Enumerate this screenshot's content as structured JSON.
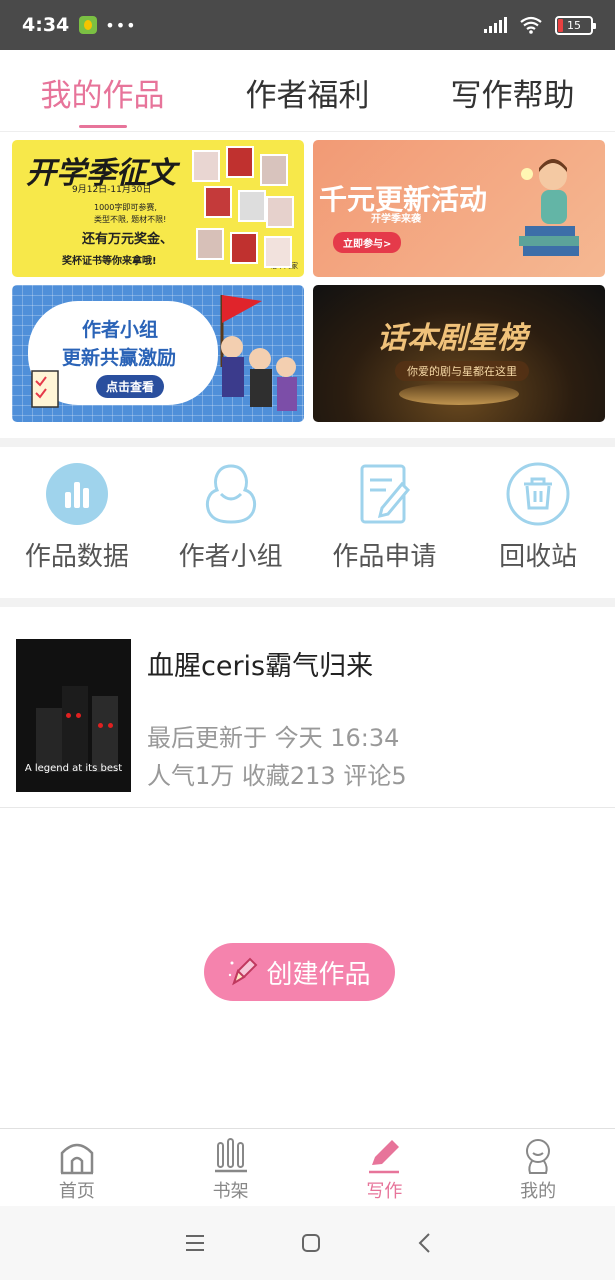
{
  "status_bar": {
    "time": "4:34",
    "dots": "•••",
    "battery": "15"
  },
  "tabs": [
    {
      "label": "我的作品",
      "active": true
    },
    {
      "label": "作者福利",
      "active": false
    },
    {
      "label": "写作帮助",
      "active": false
    }
  ],
  "banners": {
    "b1": {
      "title": "开学季征文",
      "dates": "9月12日-11月30日",
      "line1": "1000字即可参赛,",
      "line2": "类型不限, 题材不限!",
      "line3": "还有万元奖金、",
      "line4": "奖杯证书等你来拿哦!",
      "credit": "话本网家"
    },
    "b2": {
      "title": "千元更新活动",
      "subtitle": "开学季来袭",
      "button": "立即参与>"
    },
    "b3": {
      "title1": "作者小组",
      "title2": "更新共赢激励",
      "button": "点击查看"
    },
    "b4": {
      "title": "话本剧星榜",
      "subtitle": "你爱的剧与星都在这里"
    }
  },
  "quick_actions": [
    {
      "label": "作品数据",
      "icon": "bar-chart-icon"
    },
    {
      "label": "作者小组",
      "icon": "group-icon"
    },
    {
      "label": "作品申请",
      "icon": "edit-document-icon"
    },
    {
      "label": "回收站",
      "icon": "trash-icon"
    }
  ],
  "work": {
    "title": "血腥ceris霸气归来",
    "cover_caption": "A legend at its best",
    "last_update": "最后更新于 今天 16:34",
    "stats": "人气1万 收藏213 评论5"
  },
  "create_button": {
    "label": "创建作品"
  },
  "bottom_nav": [
    {
      "label": "首页",
      "icon": "home-icon",
      "active": false
    },
    {
      "label": "书架",
      "icon": "bookshelf-icon",
      "active": false
    },
    {
      "label": "写作",
      "icon": "pen-icon",
      "active": true
    },
    {
      "label": "我的",
      "icon": "profile-icon",
      "active": false
    }
  ],
  "colors": {
    "accent": "#e7749a",
    "create": "#f583ad",
    "quick_icon": "#9fd3ec"
  }
}
